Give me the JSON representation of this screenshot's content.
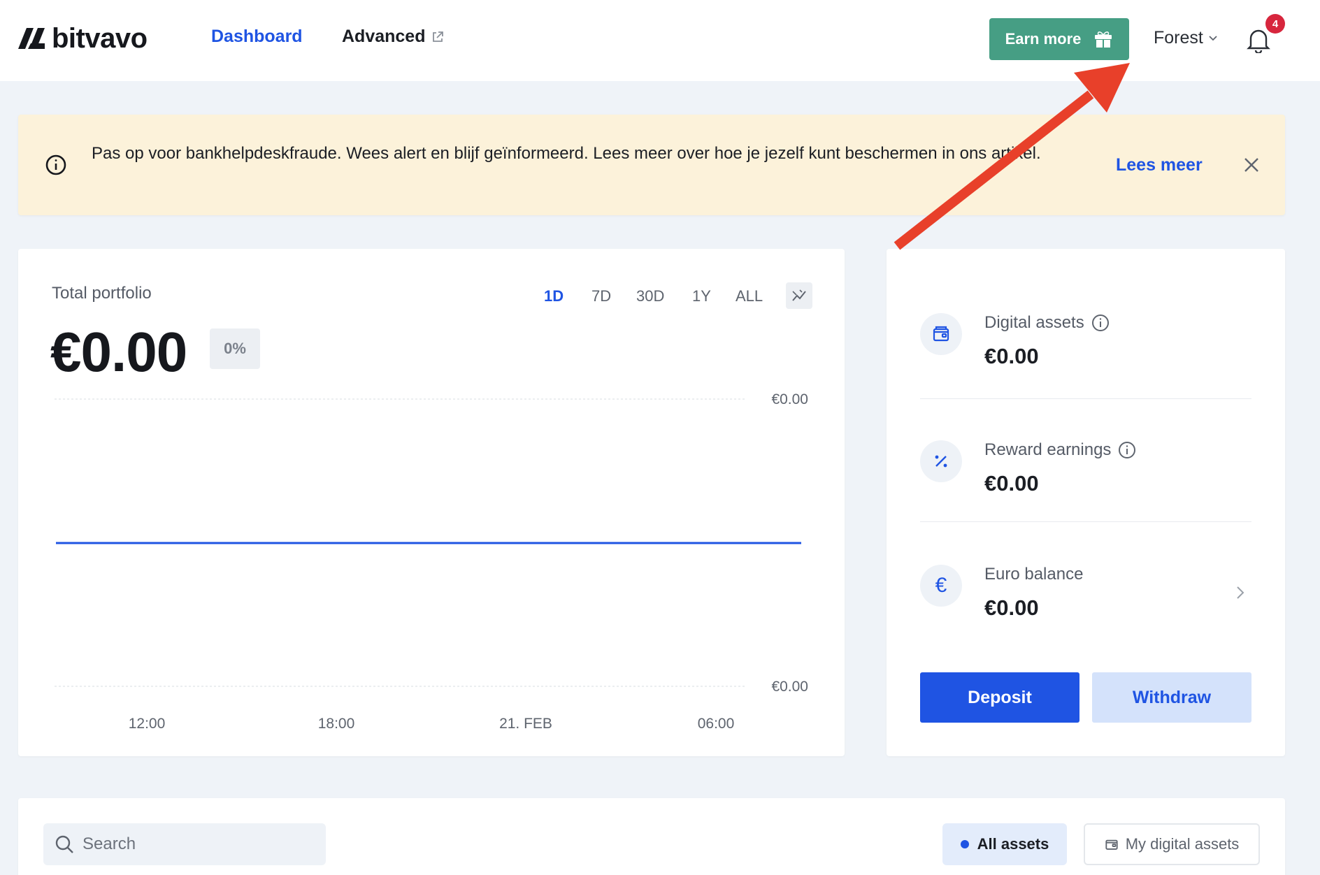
{
  "header": {
    "logo_text": "bitvavo",
    "nav": {
      "dashboard": "Dashboard",
      "advanced": "Advanced"
    },
    "earn_more": "Earn more",
    "user_name": "Forest",
    "notification_count": "4"
  },
  "banner": {
    "message": "Pas op voor bankhelpdeskfraude. Wees alert en blijf geïnformeerd. Lees meer over hoe je jezelf kunt beschermen in ons artikel.",
    "link": "Lees meer"
  },
  "portfolio": {
    "title": "Total portfolio",
    "value": "€0.00",
    "change": "0%",
    "ranges": [
      "1D",
      "7D",
      "30D",
      "1Y",
      "ALL"
    ],
    "active_range": "1D"
  },
  "chart_data": {
    "type": "line",
    "title": "",
    "xlabel": "",
    "ylabel": "",
    "x_ticks": [
      "12:00",
      "18:00",
      "21. FEB",
      "06:00"
    ],
    "y_ticks": [
      "€0.00",
      "€0.00"
    ],
    "series": [
      {
        "values": [
          0,
          0,
          0,
          0,
          0,
          0,
          0,
          0,
          0,
          0
        ]
      }
    ],
    "line_color": "#1f54e3",
    "grid": true
  },
  "balances": {
    "digital_assets": {
      "label": "Digital assets",
      "value": "€0.00",
      "icon": "wallet-icon"
    },
    "reward_earnings": {
      "label": "Reward earnings",
      "value": "€0.00",
      "icon": "percent-icon"
    },
    "euro_balance": {
      "label": "Euro balance",
      "value": "€0.00",
      "icon": "euro-icon",
      "symbol": "€"
    }
  },
  "actions": {
    "deposit": "Deposit",
    "withdraw": "Withdraw"
  },
  "assets_toolbar": {
    "search_placeholder": "Search",
    "filter_all": "All assets",
    "filter_mine": "My digital assets"
  },
  "colors": {
    "accent": "#1f54e3",
    "earn": "#469e84",
    "banner_bg": "#fcf2da",
    "badge": "#d7263d",
    "annotation_arrow": "#e8402a"
  }
}
